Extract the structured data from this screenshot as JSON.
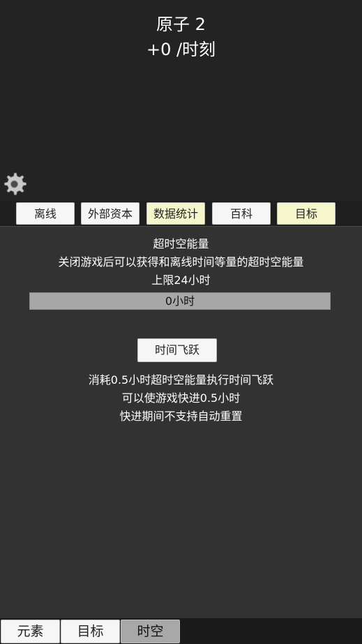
{
  "header": {
    "title": "原子 2",
    "rate": "+0 /时刻"
  },
  "settings": {
    "icon": "gear-icon"
  },
  "tabs": [
    {
      "label": "离线",
      "highlighted": false
    },
    {
      "label": "外部资本",
      "highlighted": false
    },
    {
      "label": "数据统计",
      "highlighted": true
    },
    {
      "label": "百科",
      "highlighted": false
    },
    {
      "label": "目标",
      "highlighted": true
    }
  ],
  "offline": {
    "title": "超时空能量",
    "description": "关闭游戏后可以获得和离线时间等量的超时空能量",
    "limit": "上限24小时",
    "progress_text": "0小时",
    "progress_fraction": 0,
    "leap_button": "时间飞跃",
    "info_lines": [
      "消耗0.5小时超时空能量执行时间飞跃",
      "可以使游戏快进0.5小时",
      "快进期间不支持自动重置"
    ]
  },
  "bottom_nav": [
    {
      "label": "元素",
      "active": false
    },
    {
      "label": "目标",
      "active": false
    },
    {
      "label": "时空",
      "active": true
    }
  ],
  "colors": {
    "highlight_tab": "#f5f6cc",
    "active_bottom_tab": "#a8a8a8",
    "panel_bg": "#323232"
  }
}
